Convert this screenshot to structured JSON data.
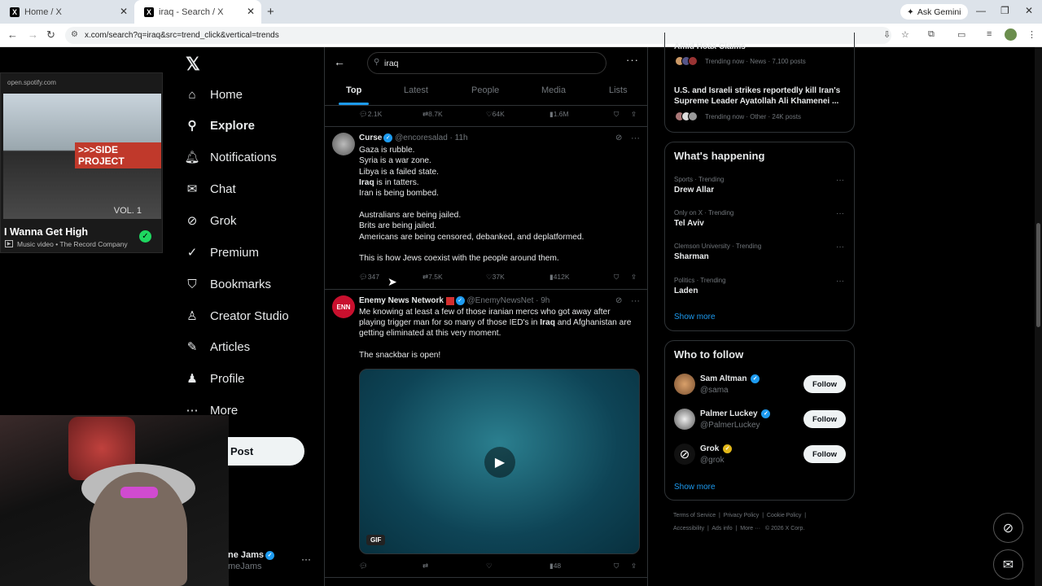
{
  "browser": {
    "tabs": [
      {
        "title": "Home / X"
      },
      {
        "title": "iraq - Search / X"
      }
    ],
    "url": "x.com/search?q=iraq&src=trend_click&vertical=trends",
    "gemini_label": "Ask Gemini"
  },
  "spotify": {
    "source": "open.spotify.com",
    "art_sign": ">>>SIDE PROJECT",
    "art_vol": "VOL. 1",
    "title": "I Wanna Get High",
    "subtitle": "Music video • The Record Company"
  },
  "nav": {
    "items": [
      {
        "label": "Home",
        "icon": "home-icon"
      },
      {
        "label": "Explore",
        "icon": "search-icon"
      },
      {
        "label": "Notifications",
        "icon": "bell-icon"
      },
      {
        "label": "Chat",
        "icon": "mail-icon"
      },
      {
        "label": "Grok",
        "icon": "grok-icon"
      },
      {
        "label": "Premium",
        "icon": "premium-icon"
      },
      {
        "label": "Bookmarks",
        "icon": "bookmark-icon"
      },
      {
        "label": "Creator Studio",
        "icon": "creator-icon"
      },
      {
        "label": "Articles",
        "icon": "articles-icon"
      },
      {
        "label": "Profile",
        "icon": "profile-icon"
      },
      {
        "label": "More",
        "icon": "more-icon"
      }
    ],
    "post_label": "Post",
    "account_name": "ne Jams",
    "account_handle": "meJams"
  },
  "search": {
    "query": "iraq",
    "tabs": [
      "Top",
      "Latest",
      "People",
      "Media",
      "Lists"
    ]
  },
  "tweet0_actions": {
    "replies": "2.1K",
    "reposts": "8.7K",
    "likes": "64K",
    "views": "1.6M"
  },
  "tweet1": {
    "name": "Curse",
    "handle": "@encoresalad",
    "time": "11h",
    "lines": [
      "Gaza is rubble.",
      "Syria is a war zone.",
      "Libya is a failed state.",
      "is in tatters.",
      "Iran is being bombed.",
      "Australians are being jailed.",
      "Brits are being jailed.",
      "Americans are being censored, debanked, and deplatformed.",
      "This is how Jews coexist with the people around them."
    ],
    "highlight": "Iraq",
    "actions": {
      "replies": "347",
      "reposts": "7.5K",
      "likes": "37K",
      "views": "412K"
    }
  },
  "tweet2": {
    "name": "Enemy News Network",
    "handle": "@EnemyNewsNet",
    "time": "9h",
    "avatar_text": "ENN",
    "line1": "Me knowing at least a few of those iranian mercs who got away after",
    "line2a": "playing trigger man for so many of those IED's in",
    "line2b": "Iraq",
    "line2c": "and Afghanistan are",
    "line3": "getting eliminated at this very moment.",
    "line4": "The snackbar is open!",
    "gif_label": "GIF",
    "actions": {
      "views": "48"
    }
  },
  "trending_top": {
    "item1_title": "Amid Hoax Claims",
    "item1_meta": "Trending now · News · 7,100 posts",
    "item2_line1": "U.S. and Israeli strikes reportedly kill Iran's",
    "item2_line2": "Supreme Leader Ayatollah Ali Khamenei ...",
    "item2_meta": "Trending now · Other · 24K posts"
  },
  "whats_happening": {
    "heading": "What's happening",
    "items": [
      {
        "context": "Sports · Trending",
        "title": "Drew Allar"
      },
      {
        "context": "Only on X · Trending",
        "title": "Tel Aviv"
      },
      {
        "context": "Clemson University · Trending",
        "title": "Sharman"
      },
      {
        "context": "Politics · Trending",
        "title": "Laden"
      }
    ],
    "show_more": "Show more"
  },
  "who_to_follow": {
    "heading": "Who to follow",
    "items": [
      {
        "name": "Sam Altman",
        "handle": "@sama"
      },
      {
        "name": "Palmer Luckey",
        "handle": "@PalmerLuckey"
      },
      {
        "name": "Grok",
        "handle": "@grok"
      }
    ],
    "follow_label": "Follow",
    "show_more": "Show more"
  },
  "footer": {
    "line1": [
      "Terms of Service",
      "Privacy Policy",
      "Cookie Policy"
    ],
    "line2": [
      "Accessibility",
      "Ads info",
      "More ···",
      "© 2026 X Corp."
    ]
  },
  "colors": {
    "accent": "#1d9bf0",
    "background": "#000000",
    "text": "#e7e9ea",
    "muted": "#71767b"
  }
}
